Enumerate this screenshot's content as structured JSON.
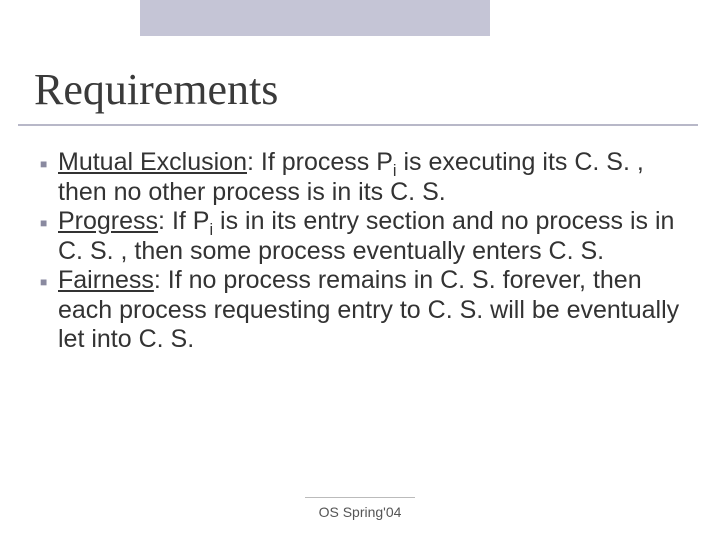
{
  "slide": {
    "title": "Requirements",
    "footer": "OS Spring'04",
    "bullets": [
      {
        "term": "Mutual Exclusion",
        "pre": ": If process P",
        "sub": "i",
        "post": " is executing its C. S. , then no other process is in its C. S."
      },
      {
        "term": "Progress",
        "pre": ": If P",
        "sub": "i",
        "post": " is in its entry section and no process is in C. S. , then some process eventually enters C. S."
      },
      {
        "term": "Fairness",
        "pre": "",
        "sub": "",
        "post": ": If no process remains in C. S. forever, then each process requesting entry to C. S. will be eventually let into C. S."
      }
    ]
  }
}
